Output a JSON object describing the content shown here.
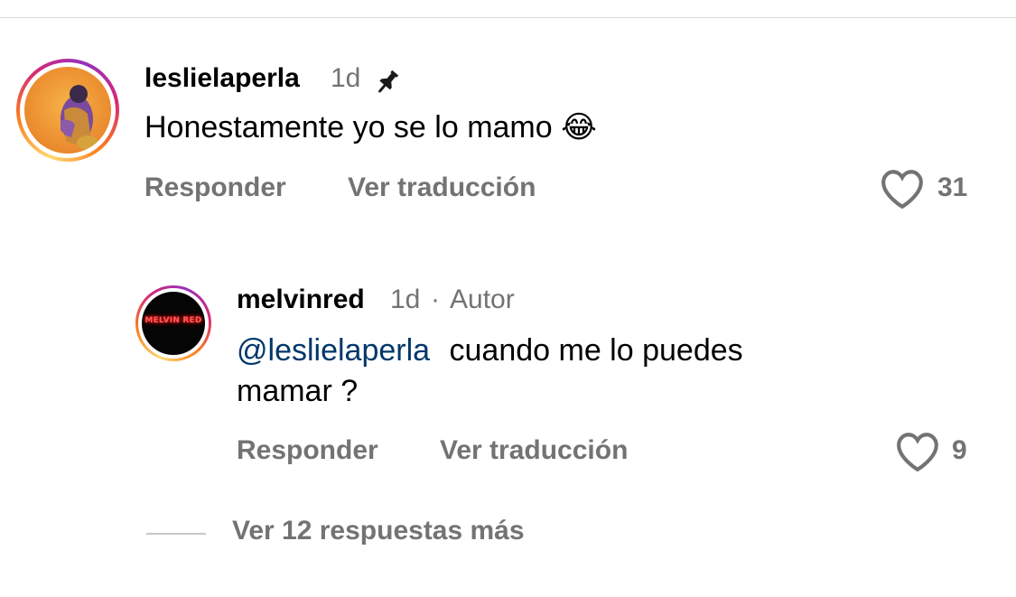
{
  "comment": {
    "username": "leslielaperla",
    "time": "1d",
    "text": "Honestamente yo se lo mamo",
    "emoji": "😂",
    "actions": {
      "reply": "Responder",
      "translate": "Ver traducción"
    },
    "likes": "31",
    "icons": {
      "pin": "pin-icon",
      "like": "heart-outline-icon"
    }
  },
  "reply": {
    "username": "melvinred",
    "time": "1d",
    "separator": "·",
    "role": "Autor",
    "avatar_logo_text": "MELVIN RED",
    "mention": "@leslielaperla",
    "text_line1": "cuando me lo puedes",
    "text_line2": "mamar ?",
    "actions": {
      "reply": "Responder",
      "translate": "Ver traducción"
    },
    "likes": "9"
  },
  "more_replies": "Ver 12 respuestas más",
  "colors": {
    "secondary_text": "#737373",
    "mention": "#00376b",
    "divider": "#dbdbdb",
    "story_ring": [
      "#feda75",
      "#fa7e1e",
      "#d62976",
      "#962fbf"
    ]
  }
}
